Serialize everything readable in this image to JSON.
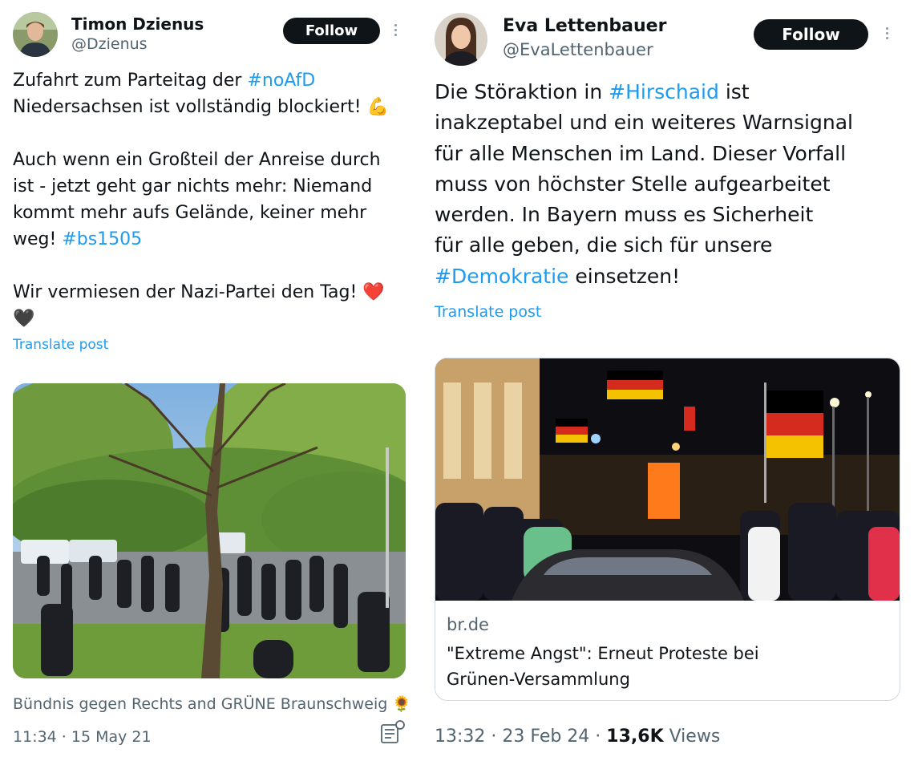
{
  "left_post": {
    "author_name": "Timon Dzienus",
    "author_handle": "@Dzienus",
    "follow_label": "Follow",
    "lines": [
      [
        "Zufahrt zum Parteitag der ",
        "#noAfD"
      ],
      [
        "Niedersachsen ist vollständig blockiert! 💪",
        ""
      ],
      [
        "",
        ""
      ],
      [
        "Auch wenn ein Großteil der Anreise durch",
        ""
      ],
      [
        "ist - jetzt geht gar nichts mehr: Niemand",
        ""
      ],
      [
        "kommt mehr aufs Gelände, keiner mehr",
        ""
      ],
      [
        "weg! ",
        "#bs1505"
      ],
      [
        "",
        ""
      ],
      [
        "Wir vermiesen der Nazi-Partei den Tag! ❤️",
        ""
      ],
      [
        "🖤",
        ""
      ]
    ],
    "translate_label": "Translate post",
    "tagged_accounts": "Bündnis gegen Rechts and GRÜNE Braunschweig 🌻",
    "timestamp": "11:34 · 15 May 21"
  },
  "right_post": {
    "author_name": "Eva Lettenbauer",
    "author_handle": "@EvaLettenbauer",
    "follow_label": "Follow",
    "lines": [
      [
        "Die Störaktion in ",
        "#Hirschaid",
        " ist"
      ],
      [
        "inakzeptabel und ein weiteres Warnsignal",
        "",
        ""
      ],
      [
        "für alle Menschen im Land. Dieser Vorfall",
        "",
        ""
      ],
      [
        "muss von höchster Stelle aufgearbeitet",
        "",
        ""
      ],
      [
        "werden. In Bayern muss es Sicherheit",
        "",
        ""
      ],
      [
        "für alle geben, die sich für unsere",
        "",
        ""
      ],
      [
        "",
        "#Demokratie",
        " einsetzen!"
      ]
    ],
    "translate_label": "Translate post",
    "card": {
      "domain": "br.de",
      "title_line1": "\"Extreme Angst\": Erneut Proteste bei",
      "title_line2": "Grünen-Versammlung"
    },
    "time": "13:32 · 23 Feb 24 · ",
    "views_count": "13,6K",
    "views_label": " Views"
  },
  "icons": {
    "more": "more-icon",
    "tag_people": "tag-people-icon"
  },
  "colors": {
    "link": "#1d9bf0",
    "text": "#0f1419",
    "muted": "#536471",
    "follow_bg": "#0f1419"
  }
}
